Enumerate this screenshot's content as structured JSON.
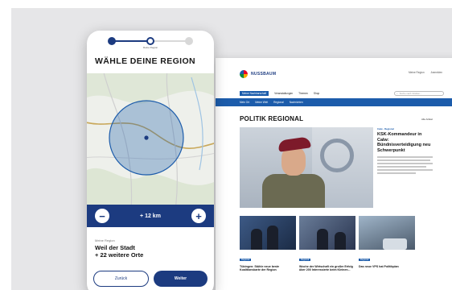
{
  "phone": {
    "step_label": "Deine Region",
    "title": "WÄHLE DEINE REGION",
    "radius": {
      "minus": "−",
      "value": "+ 12 km",
      "plus": "+"
    },
    "selection": {
      "label": "Meine Region",
      "value_line1": "Weil der Stadt",
      "value_line2": "+ 22 weitere Orte"
    },
    "buttons": {
      "back": "Zurück",
      "next": "Weiter"
    },
    "map": {
      "circle_color": "#1c5cab"
    }
  },
  "desktop": {
    "logo": "NUSSBAUM",
    "util": [
      "Meine Region",
      "Anmelden"
    ],
    "nav": [
      "Meine Nachbarschaft",
      "Veranstaltungen",
      "Themen",
      "Shop"
    ],
    "search_placeholder": "Suche nach Inhalten...",
    "subnav": [
      "Mein Ort",
      "Meine Welt",
      "Regional",
      "Nachrichten"
    ],
    "section_title": "POLITIK REGIONAL",
    "all_link": "Alle Artikel",
    "hero": {
      "tag": "Calw · Regional",
      "headline": "KSK-Kommandeur in Calw: Bündnisverteidigung neu Schwerpunkt"
    },
    "cards": [
      {
        "tag": "Regional",
        "headline": "Tübingen: Stühle neue beste Koalitionskarte der Region"
      },
      {
        "tag": "Regional",
        "headline": "Woche der Wirtschaft ein großer Erfolg über 200 Interessierte beim Kleinen..."
      },
      {
        "tag": "Regional",
        "headline": "Das neue VPS hat Politikplan"
      }
    ]
  },
  "colors": {
    "brand_blue": "#1c3b80",
    "accent_blue": "#1c5cab",
    "background": "#e6e6e8"
  }
}
